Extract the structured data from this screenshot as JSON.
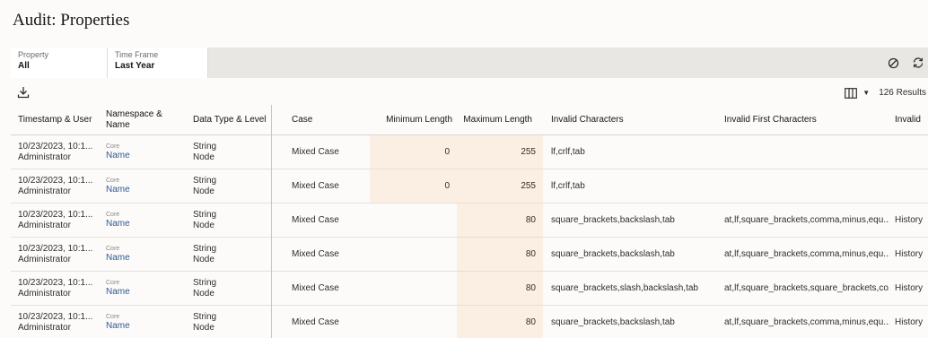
{
  "page": {
    "title": "Audit: Properties"
  },
  "filters": {
    "property": {
      "label": "Property",
      "value": "All"
    },
    "time_frame": {
      "label": "Time Frame",
      "value": "Last Year"
    }
  },
  "actions": {
    "clear_icon": "clear-filter-icon",
    "refresh_icon": "refresh-icon"
  },
  "toolbar": {
    "download_icon": "download-icon",
    "columns_icon": "columns-icon",
    "results": "126 Results"
  },
  "colors": {
    "highlight": "#fbeee2",
    "link": "#2c5b8e",
    "filter_bar": "#e9e7e3"
  },
  "table": {
    "headers": {
      "timestamp": "Timestamp & User",
      "namespace_line1": "Namespace &",
      "namespace_line2": "Name",
      "datatype": "Data Type & Level",
      "case": "Case",
      "min_length": "Minimum Length",
      "max_length": "Maximum Length",
      "invalid_chars": "Invalid Characters",
      "invalid_first": "Invalid First Characters",
      "invalid_more": "Invalid"
    },
    "rows": [
      {
        "timestamp": "10/23/2023, 10:1...",
        "user": "Administrator",
        "namespace": "Core",
        "name": "Name",
        "datatype": "String",
        "level": "Node",
        "case": "Mixed Case",
        "min": "0",
        "max": "255",
        "invalid_chars": "lf,crlf,tab",
        "invalid_first": "",
        "invalid_more": ""
      },
      {
        "timestamp": "10/23/2023, 10:1...",
        "user": "Administrator",
        "namespace": "Core",
        "name": "Name",
        "datatype": "String",
        "level": "Node",
        "case": "Mixed Case",
        "min": "0",
        "max": "255",
        "invalid_chars": "lf,crlf,tab",
        "invalid_first": "",
        "invalid_more": ""
      },
      {
        "timestamp": "10/23/2023, 10:1...",
        "user": "Administrator",
        "namespace": "Core",
        "name": "Name",
        "datatype": "String",
        "level": "Node",
        "case": "Mixed Case",
        "min": "",
        "max": "80",
        "invalid_chars": "square_brackets,backslash,tab",
        "invalid_first": "at,lf,square_brackets,comma,minus,equ...",
        "invalid_more": "History"
      },
      {
        "timestamp": "10/23/2023, 10:1...",
        "user": "Administrator",
        "namespace": "Core",
        "name": "Name",
        "datatype": "String",
        "level": "Node",
        "case": "Mixed Case",
        "min": "",
        "max": "80",
        "invalid_chars": "square_brackets,backslash,tab",
        "invalid_first": "at,lf,square_brackets,comma,minus,equ...",
        "invalid_more": "History"
      },
      {
        "timestamp": "10/23/2023, 10:1...",
        "user": "Administrator",
        "namespace": "Core",
        "name": "Name",
        "datatype": "String",
        "level": "Node",
        "case": "Mixed Case",
        "min": "",
        "max": "80",
        "invalid_chars": "square_brackets,slash,backslash,tab",
        "invalid_first": "at,lf,square_brackets,square_brackets,co...",
        "invalid_more": "History"
      },
      {
        "timestamp": "10/23/2023, 10:1...",
        "user": "Administrator",
        "namespace": "Core",
        "name": "Name",
        "datatype": "String",
        "level": "Node",
        "case": "Mixed Case",
        "min": "",
        "max": "80",
        "invalid_chars": "square_brackets,backslash,tab",
        "invalid_first": "at,lf,square_brackets,comma,minus,equ...",
        "invalid_more": "History"
      }
    ]
  }
}
